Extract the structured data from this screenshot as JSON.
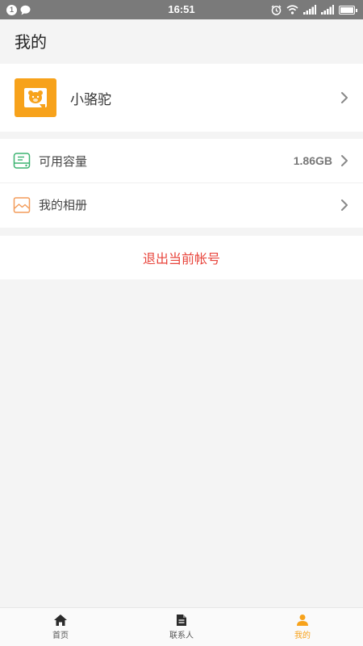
{
  "status_bar": {
    "notification_count": "1",
    "time": "16:51",
    "icons": [
      "chat-bubble-icon",
      "alarm-icon",
      "wifi-icon",
      "signal-icon",
      "signal-icon",
      "battery-icon"
    ]
  },
  "header": {
    "title": "我的"
  },
  "profile": {
    "name": "小骆驼",
    "avatar_color": "#f7a21b"
  },
  "menu": [
    {
      "icon": "storage-icon",
      "label": "可用容量",
      "value": "1.86GB",
      "icon_color": "#3cb371"
    },
    {
      "icon": "album-icon",
      "label": "我的相册",
      "value": "",
      "icon_color": "#f39c5a"
    }
  ],
  "logout": {
    "label": "退出当前帐号",
    "color": "#e8453c"
  },
  "tabbar": {
    "active_color": "#f7a21b",
    "tabs": [
      {
        "label": "首页",
        "icon": "home-icon",
        "active": false
      },
      {
        "label": "联系人",
        "icon": "document-icon",
        "active": false
      },
      {
        "label": "我的",
        "icon": "person-icon",
        "active": true
      }
    ]
  }
}
